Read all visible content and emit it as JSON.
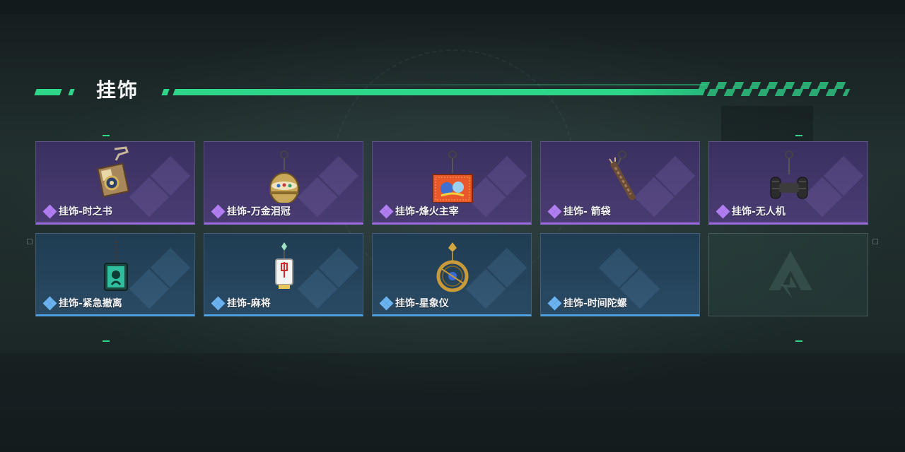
{
  "section": {
    "title": "挂饰"
  },
  "items": [
    {
      "name": "挂饰-时之书",
      "rarity": "purple",
      "icon": "book-of-time-charm-icon"
    },
    {
      "name": "挂饰-万金泪冠",
      "rarity": "purple",
      "icon": "golden-crown-egg-charm-icon"
    },
    {
      "name": "挂饰-烽火主宰",
      "rarity": "purple",
      "icon": "beacon-ruler-card-charm-icon"
    },
    {
      "name": "挂饰- 箭袋",
      "rarity": "purple",
      "icon": "quiver-charm-icon"
    },
    {
      "name": "挂饰-无人机",
      "rarity": "purple",
      "icon": "drone-charm-icon"
    },
    {
      "name": "挂饰-紧急撤离",
      "rarity": "blue",
      "icon": "emergency-evac-charm-icon"
    },
    {
      "name": "挂饰-麻将",
      "rarity": "blue",
      "icon": "mahjong-tile-charm-icon"
    },
    {
      "name": "挂饰-星象仪",
      "rarity": "blue",
      "icon": "astrolabe-charm-icon"
    },
    {
      "name": "挂饰-时间陀螺",
      "rarity": "blue",
      "icon": "time-gyro-charm-icon"
    }
  ],
  "colors": {
    "accent_green": "#2ed68a",
    "rarity_purple": "#9b6be0",
    "rarity_blue": "#4fa0e0"
  },
  "empty_slot_icon": "delta-logo-icon"
}
